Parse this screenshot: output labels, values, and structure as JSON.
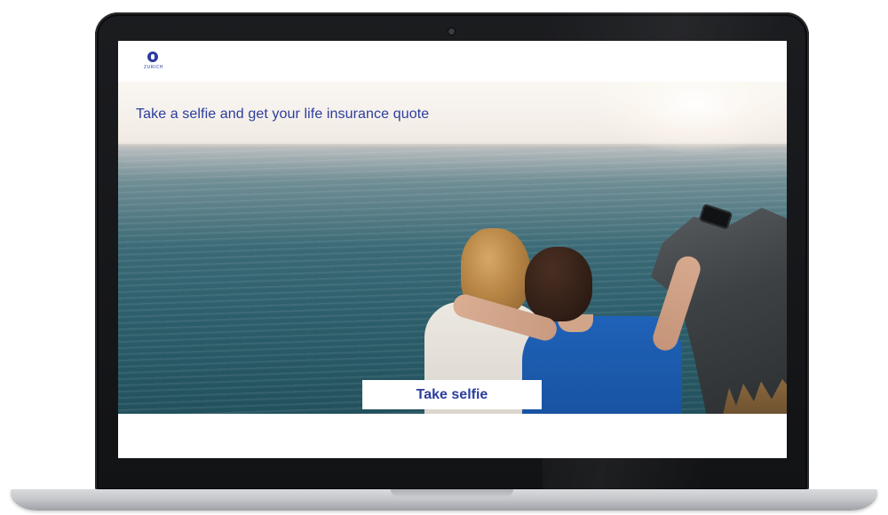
{
  "brand": {
    "logo_text": "ZURICH",
    "color": "#2b3d9e"
  },
  "hero": {
    "headline": "Take a selfie and get your life insurance quote",
    "cta_label": "Take selfie"
  },
  "colors": {
    "accent": "#2b3d9e",
    "bezel": "#121315",
    "screen_background": "#ffffff"
  }
}
